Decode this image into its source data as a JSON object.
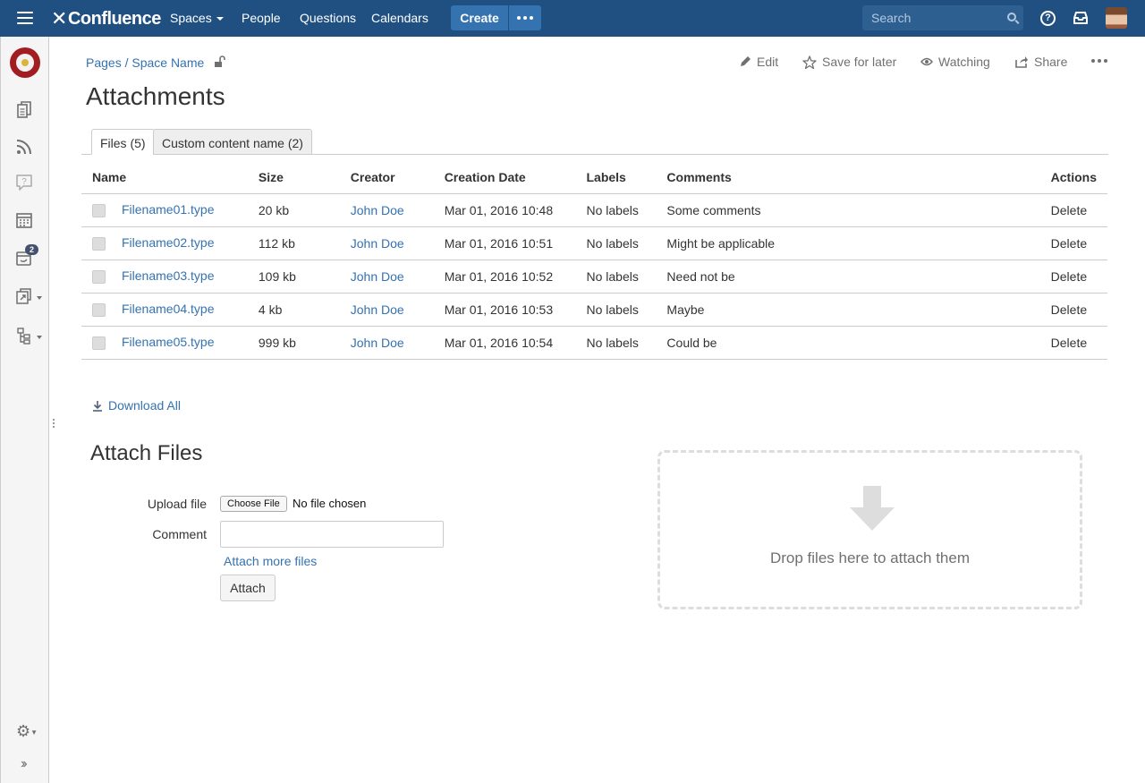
{
  "header": {
    "logo": "Confluence",
    "nav": [
      "Spaces",
      "People",
      "Questions",
      "Calendars"
    ],
    "create_label": "Create",
    "search_placeholder": "Search"
  },
  "sidebar": {
    "notification_count": "2"
  },
  "breadcrumb": "Pages / Space Name",
  "page_actions": {
    "edit": "Edit",
    "save_for_later": "Save for later",
    "watching": "Watching",
    "share": "Share"
  },
  "title": "Attachments",
  "tabs": [
    "Files (5)",
    "Custom content name (2)"
  ],
  "table": {
    "headers": [
      "Name",
      "Size",
      "Creator",
      "Creation Date",
      "Labels",
      "Comments",
      "Actions"
    ],
    "rows": [
      {
        "name": "Filename01.type",
        "size": "20 kb",
        "creator": "John Doe",
        "date": "Mar 01, 2016 10:48",
        "labels": "No labels",
        "comment": "Some comments",
        "action": "Delete"
      },
      {
        "name": "Filename02.type",
        "size": "112 kb",
        "creator": "John Doe",
        "date": "Mar 01, 2016 10:51",
        "labels": "No labels",
        "comment": "Might be applicable",
        "action": "Delete"
      },
      {
        "name": "Filename03.type",
        "size": "109 kb",
        "creator": "John Doe",
        "date": "Mar 01, 2016 10:52",
        "labels": "No labels",
        "comment": "Need not be",
        "action": "Delete"
      },
      {
        "name": "Filename04.type",
        "size": "4 kb",
        "creator": "John Doe",
        "date": "Mar 01, 2016 10:53",
        "labels": "No labels",
        "comment": "Maybe",
        "action": "Delete"
      },
      {
        "name": "Filename05.type",
        "size": "999 kb",
        "creator": "John Doe",
        "date": "Mar 01, 2016 10:54",
        "labels": "No labels",
        "comment": "Could be",
        "action": "Delete"
      }
    ]
  },
  "download_all": "Download All",
  "attach": {
    "title": "Attach Files",
    "upload_label": "Upload file",
    "choose_file": "Choose File",
    "no_file": "No file chosen",
    "comment_label": "Comment",
    "attach_more": "Attach more files",
    "attach_button": "Attach"
  },
  "dropzone_text": "Drop files here to attach them"
}
